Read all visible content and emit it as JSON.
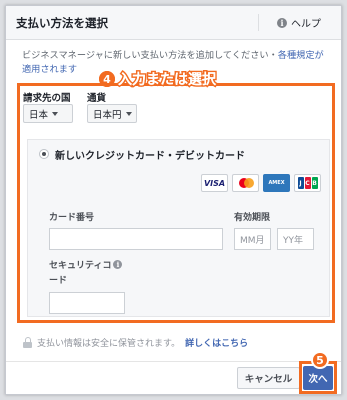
{
  "dialog": {
    "title": "支払い方法を選択",
    "help_label": "ヘルプ",
    "description": "ビジネスマネージャに新しい支払い方法を追加してください・",
    "terms_link": "各種規定が適用されます"
  },
  "annotation": {
    "step4_number": "4",
    "step4_text": "入力または選択",
    "step5_number": "5",
    "highlight_color": "#f26b21"
  },
  "billing": {
    "country_label": "請求先の国",
    "country_value": "日本",
    "currency_label": "通貨",
    "currency_value": "日本円"
  },
  "card": {
    "option_label": "新しいクレジットカード・デビットカード",
    "logos": [
      "VISA",
      "MasterCard",
      "AMERICAN EXPRESS",
      "JCB"
    ],
    "card_number_label": "カード番号",
    "expiry_label": "有効期限",
    "month_placeholder": "MM月",
    "year_placeholder": "YY年",
    "security_code_label_1": "セキュリティコ",
    "security_code_label_2": "ード"
  },
  "secure_notice": {
    "text": "支払い情報は安全に保管されます。",
    "link": "詳しくはこちら"
  },
  "footer": {
    "cancel_label": "キャンセル",
    "next_label": "次へ"
  },
  "colors": {
    "accent": "#4267b2",
    "highlight": "#f26b21"
  }
}
